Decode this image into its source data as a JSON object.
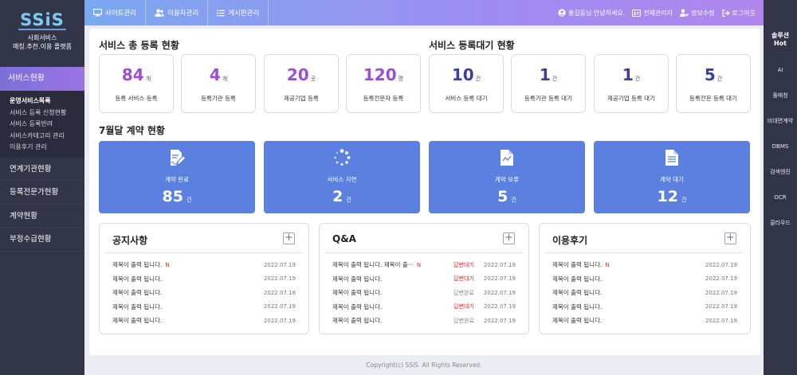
{
  "logo": {
    "mark": "SSiS",
    "line1": "사회서비스",
    "line2": "매칭.추천.이용 플랫폼"
  },
  "sidebar": {
    "active": "서비스현황",
    "submenu": [
      {
        "label": "운영서비스목록",
        "strong": true
      },
      {
        "label": "서비스 등록 신청현황"
      },
      {
        "label": "서비스 등록반려"
      },
      {
        "label": "서비스카테고리 관리"
      },
      {
        "label": "이용후기 관리"
      }
    ],
    "items": [
      {
        "label": "연계기관현황"
      },
      {
        "label": "등록전문가현황"
      },
      {
        "label": "계약현황"
      },
      {
        "label": "부정수급현황"
      }
    ]
  },
  "topnav": [
    {
      "label": "사이트관리",
      "icon": "monitor-icon"
    },
    {
      "label": "이용자관리",
      "icon": "users-icon"
    },
    {
      "label": "게시판관리",
      "icon": "list-icon"
    }
  ],
  "topright": {
    "greeting": "홍길동님 안녕하세요.",
    "admins": "전체관리자",
    "profile": "정보수정",
    "logout": "로그아웃"
  },
  "rightbar": {
    "title_line1": "솔루션",
    "title_line2": "Hot",
    "items": [
      "AI",
      "풀매칭",
      "비대면계약",
      "DBMS",
      "검색엔진",
      "OCR",
      "클라우드"
    ]
  },
  "registration": {
    "title": "서비스 총 등록 현황",
    "stats": [
      {
        "value": "84",
        "unit": "개",
        "label": "등록 서비스 등록"
      },
      {
        "value": "4",
        "unit": "개",
        "label": "등록기관 등록"
      },
      {
        "value": "20",
        "unit": "곳",
        "label": "제공기업 등록"
      },
      {
        "value": "120",
        "unit": "명",
        "label": "등록전문자 등록"
      }
    ]
  },
  "pending": {
    "title": "서비스 등록대기 현황",
    "stats": [
      {
        "value": "10",
        "unit": "건",
        "label": "서비스 등록 대기"
      },
      {
        "value": "1",
        "unit": "건",
        "label": "등록기관 등록 대기"
      },
      {
        "value": "1",
        "unit": "건",
        "label": "제공기업 등록 대기"
      },
      {
        "value": "5",
        "unit": "건",
        "label": "등록전문 등록 대기"
      }
    ]
  },
  "contracts": {
    "title": "7월달 계약 현황",
    "cards": [
      {
        "label": "계약 완료",
        "value": "85",
        "unit": "건",
        "icon": "signed-document-icon"
      },
      {
        "label": "서비스 지연",
        "value": "2",
        "unit": "건",
        "icon": "loading-spinner-icon"
      },
      {
        "label": "계약 보류",
        "value": "5",
        "unit": "건",
        "icon": "chart-document-icon"
      },
      {
        "label": "계약 대기",
        "value": "12",
        "unit": "건",
        "icon": "text-document-icon"
      }
    ]
  },
  "boards": {
    "notice": {
      "title": "공지사항",
      "rows": [
        {
          "title": "제목이 출력 됩니다.",
          "new": "N",
          "date": "2022.07.19"
        },
        {
          "title": "제목이 출력 됩니다.",
          "date": "2022.07.19"
        },
        {
          "title": "제목이 출력 됩니다.",
          "date": "2022.07.19"
        },
        {
          "title": "제목이 출력 됩니다.",
          "date": "2022.07.19"
        },
        {
          "title": "제목이 출력 됩니다.",
          "date": "2022.07.19"
        }
      ]
    },
    "qna": {
      "title": "Q&A",
      "rows": [
        {
          "title": "제목이 출력 됩니다. 제목이 출···",
          "new": "N",
          "status": "답변대기",
          "date": "2022.07.19"
        },
        {
          "title": "제목이 출력 됩니다.",
          "status": "답변대기",
          "date": "2022.07.19"
        },
        {
          "title": "제목이 출력 됩니다.",
          "status": "답변완료",
          "date": "2022.07.19"
        },
        {
          "title": "제목이 출력 됩니다.",
          "status": "답변대기",
          "date": "2022.07.19"
        },
        {
          "title": "제목이 출력 됩니다.",
          "status": "답변완료",
          "date": "2022.07.19"
        }
      ]
    },
    "review": {
      "title": "이용후기",
      "rows": [
        {
          "title": "제목이 출력 됩니다.",
          "new": "N",
          "date": "2022.07.19"
        },
        {
          "title": "제목이 출력 됩니다.",
          "date": "2022.07.19"
        },
        {
          "title": "제목이 출력 됩니다.",
          "date": "2022.07.19"
        },
        {
          "title": "제목이 출력 됩니다.",
          "date": "2022.07.19"
        },
        {
          "title": "제목이 출력 됩니다.",
          "date": "2022.07.19"
        }
      ]
    },
    "add_symbol": "+"
  },
  "footer": "Copyright(c) SSiS. All Rights Reserved.",
  "colors": {
    "sidebar": "#323447",
    "accent_purple": "#9b4fd2",
    "accent_navy": "#3d3f9c",
    "card_blue": "#5b80e0",
    "alert_red": "#e02525"
  }
}
